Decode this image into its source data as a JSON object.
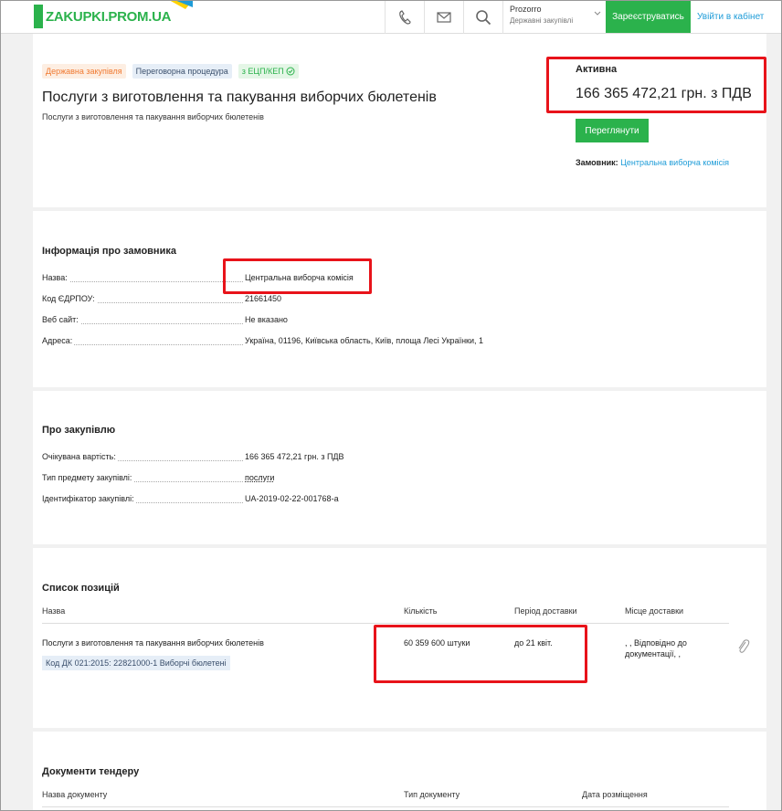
{
  "header": {
    "logo": "ZAKUPKI.PROM.UA",
    "prozorro_title": "Prozorro",
    "prozorro_sub": "Державні закупівлі",
    "register_label": "Зареєструватись",
    "login_label": "Увійти в кабінет"
  },
  "tender": {
    "badges": [
      "Державна закупівля",
      "Переговорна процедура",
      "з ЕЦП/КЕП"
    ],
    "title": "Послуги з виготовлення та пакування виборчих бюлетенів",
    "subtitle": "Послуги з виготовлення та пакування виборчих бюлетенів",
    "status": "Активна",
    "price": "166 365 472,21 грн. з ПДВ",
    "view_label": "Переглянути",
    "customer_label": "Замовник:",
    "customer_name": "Центральна виборча комісія"
  },
  "customer_info": {
    "title": "Інформація про замовника",
    "rows": [
      {
        "label": "Назва:",
        "value": "Центральна виборча комісія"
      },
      {
        "label": "Код ЄДРПОУ:",
        "value": "21661450"
      },
      {
        "label": "Веб сайт:",
        "value": "Не вказано"
      },
      {
        "label": "Адреса:",
        "value": "Україна, 01196, Київська область, Київ, площа Лесі Українки, 1"
      }
    ]
  },
  "procurement": {
    "title": "Про закупівлю",
    "rows": [
      {
        "label": "Очікувана вартість:",
        "value": "166 365 472,21 грн. з ПДВ"
      },
      {
        "label": "Тип предмету закупівлі:",
        "value": "послуги"
      },
      {
        "label": "Ідентифікатор закупівлі:",
        "value": "UA-2019-02-22-001768-a"
      }
    ]
  },
  "items": {
    "title": "Список позицій",
    "headers": [
      "Назва",
      "Кількість",
      "Період доставки",
      "Місце доставки"
    ],
    "row": {
      "name": "Послуги з виготовлення та пакування виборчих бюлетенів",
      "quantity": "60 359 600 штуки",
      "period": "до 21 квіт.",
      "place_line1": ", , Відповідно до",
      "place_line2": "документації, ,",
      "cpv": "Код ДК 021:2015: 22821000-1 Виборчі бюлетені"
    }
  },
  "documents": {
    "title": "Документи тендеру",
    "headers": [
      "Назва документу",
      "Тип документу",
      "Дата розміщення"
    ]
  },
  "colors": {
    "accent_green": "#2bb24c",
    "link_blue": "#1e9cd8",
    "highlight_red": "#e8131a"
  }
}
